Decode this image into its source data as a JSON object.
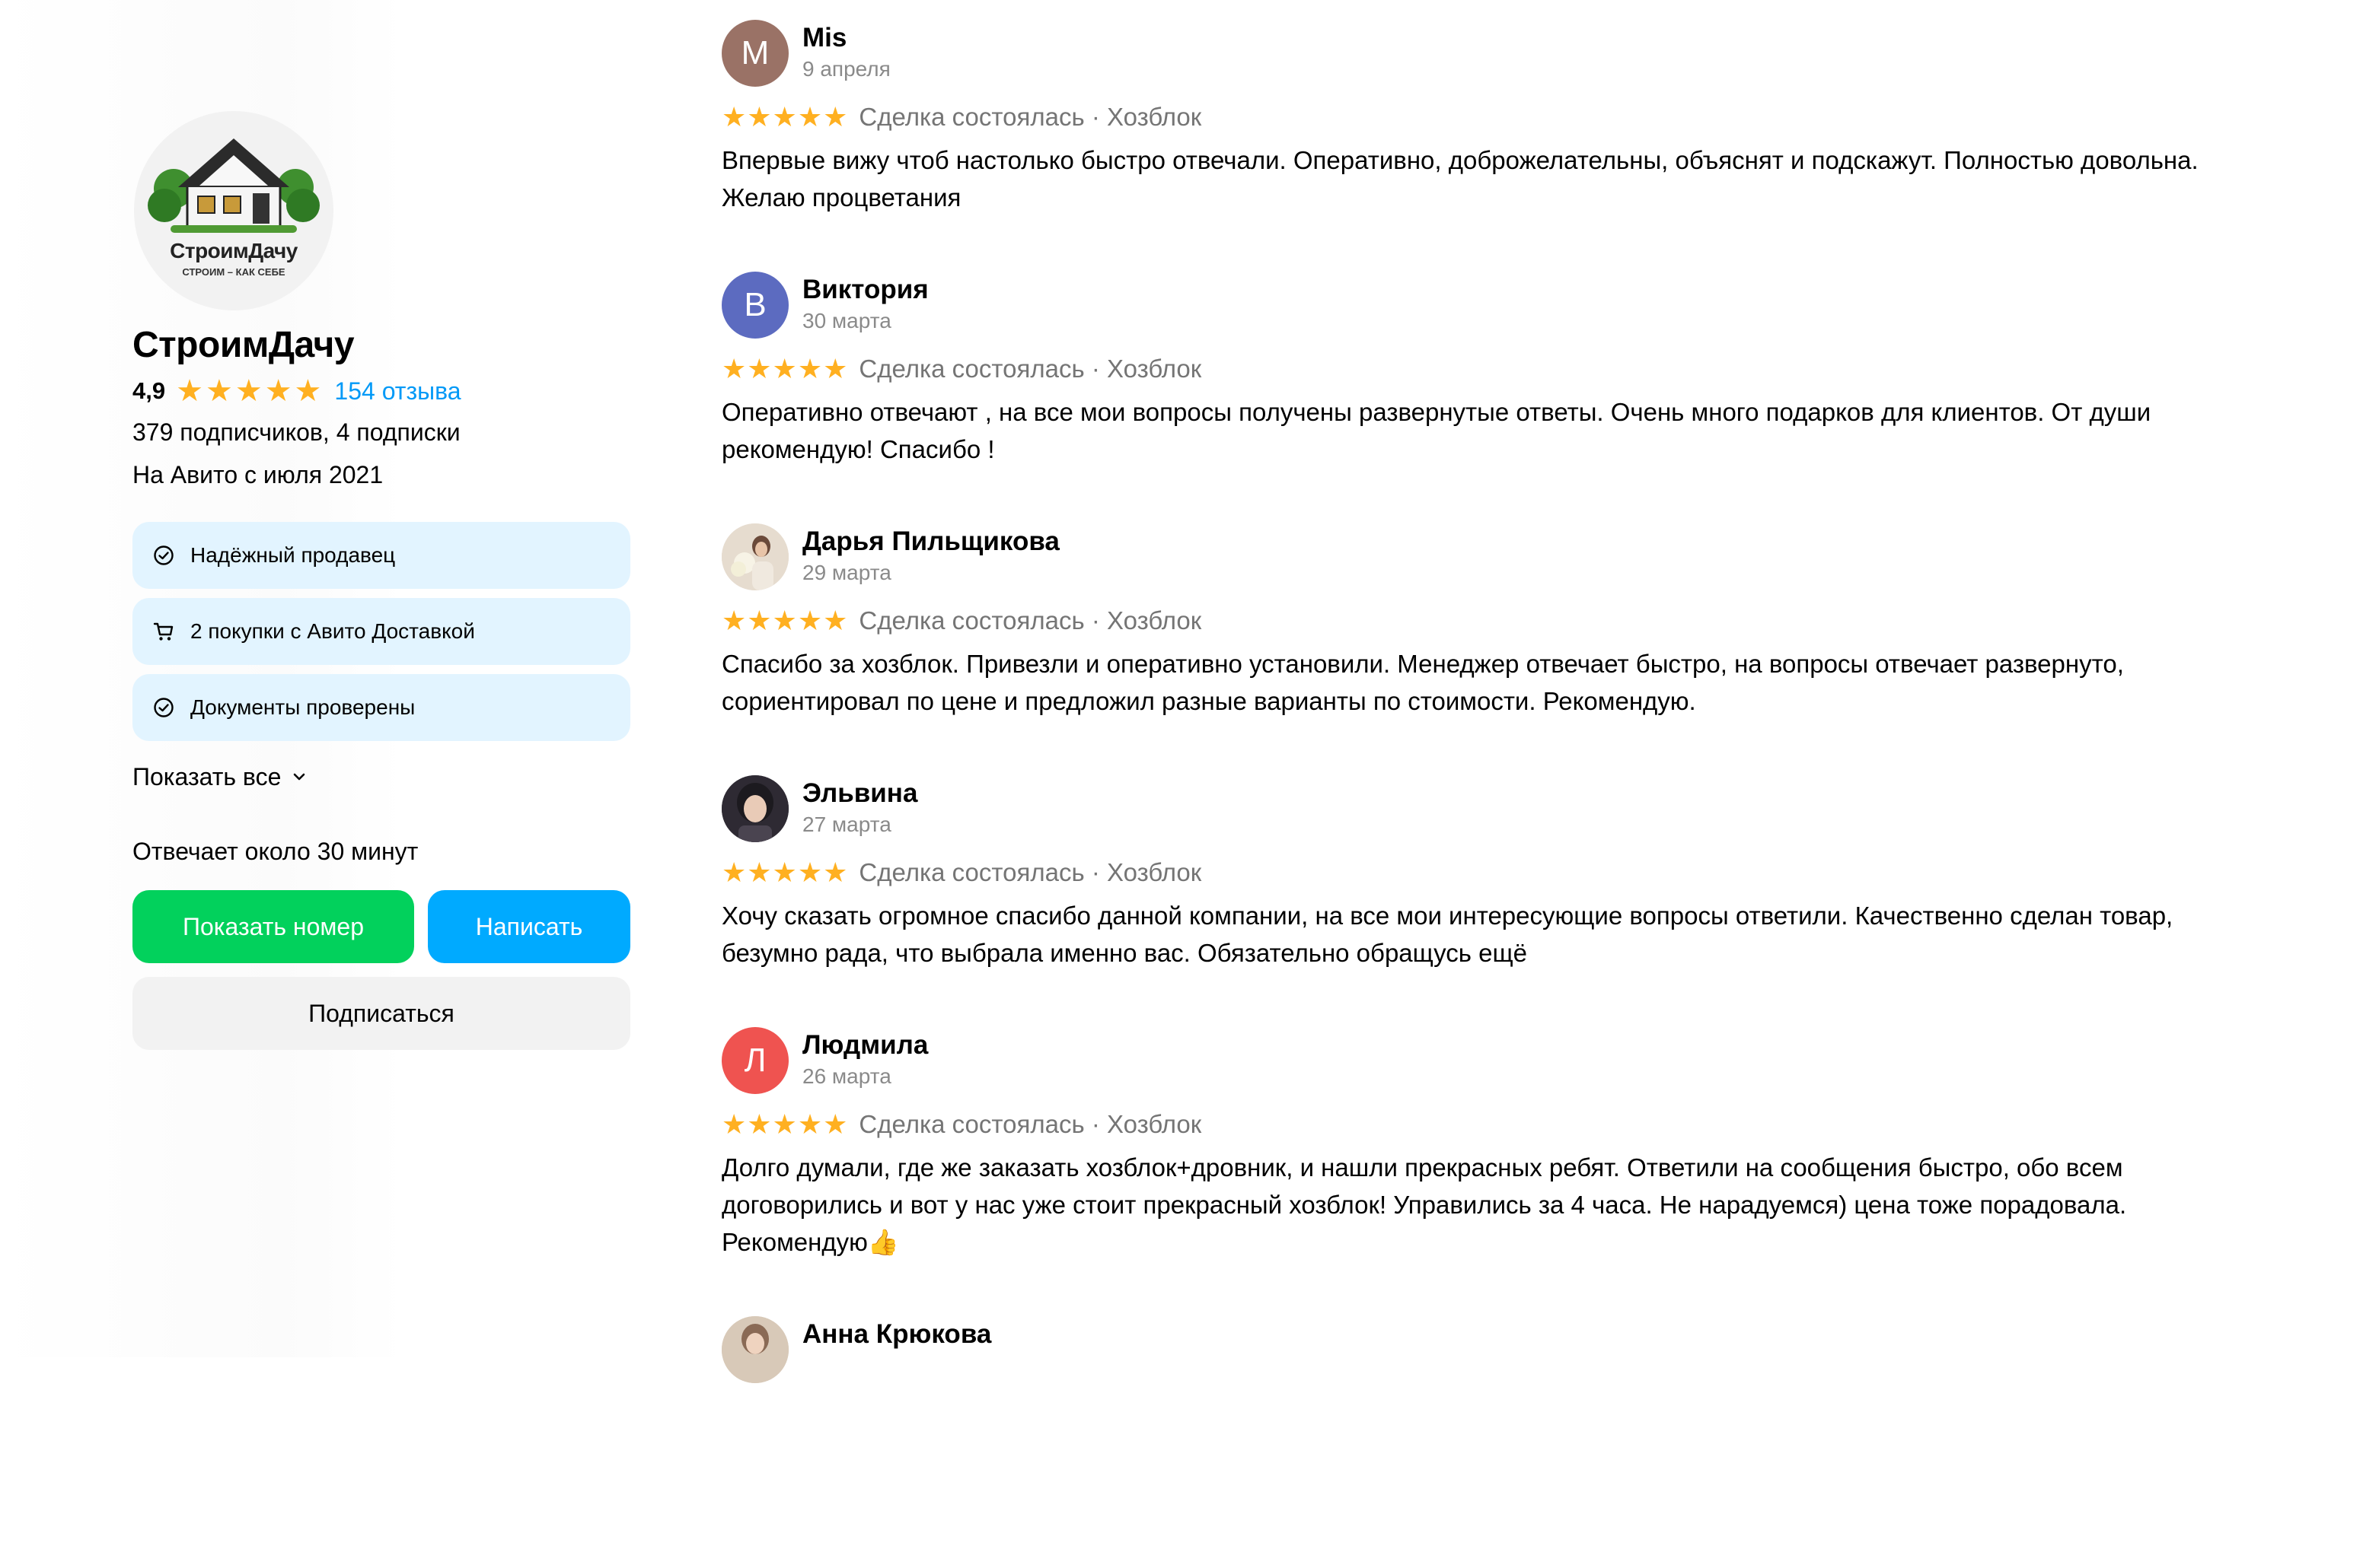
{
  "seller": {
    "logo_title": "СтроимДачу",
    "logo_subtitle": "СТРОИМ – КАК СЕБЕ",
    "name": "СтроимДачу",
    "rating": "4,9",
    "stars": "★★★★★",
    "reviews_link": "154 отзыва",
    "followers": "379 подписчиков, 4 подписки",
    "since": "На Авито с июля 2021",
    "badges": [
      {
        "icon": "check-circle-icon",
        "label": "Надёжный продавец"
      },
      {
        "icon": "cart-icon",
        "label": "2 покупки с Авито Доставкой"
      },
      {
        "icon": "check-circle-icon",
        "label": "Документы проверены"
      }
    ],
    "show_all": "Показать все",
    "response_time": "Отвечает около 30 минут",
    "show_phone_label": "Показать номер",
    "write_label": "Написать",
    "subscribe_label": "Подписаться"
  },
  "colors": {
    "green_button": "#02d15c",
    "blue_button": "#00aaff",
    "badge_bg": "#e2f4ff",
    "star": "#ffb021",
    "link": "#0099f7"
  },
  "reviews": [
    {
      "author": "Mis",
      "initial": "М",
      "avatar_color": "#9a7266",
      "avatar_type": "letter",
      "date": "9 апреля",
      "stars": "★★★★★",
      "deal": "Сделка состоялась · Хозблок",
      "text": "Впервые вижу чтоб настолько быстро отвечали. Оперативно, доброжелательны, объяснят и подскажут. Полностью довольна. Желаю процветания"
    },
    {
      "author": "Виктория",
      "initial": "В",
      "avatar_color": "#5c6bc0",
      "avatar_type": "letter",
      "date": "30 марта",
      "stars": "★★★★★",
      "deal": "Сделка состоялась · Хозблок",
      "text": "Оперативно отвечают , на все мои вопросы получены развернутые ответы. Очень много подарков для клиентов. От души рекомендую! Спасибо !"
    },
    {
      "author": "Дарья Пильщикова",
      "initial": "",
      "avatar_color": "#d9c9b5",
      "avatar_type": "photo",
      "date": "29 марта",
      "stars": "★★★★★",
      "deal": "Сделка состоялась · Хозблок",
      "text": "Спасибо за хозблок. Привезли и оперативно установили. Менеджер отвечает быстро, на вопросы отвечает развернуто, сориентировал по цене и предложил разные варианты по стоимости. Рекомендую."
    },
    {
      "author": "Эльвина",
      "initial": "",
      "avatar_color": "#3a3540",
      "avatar_type": "photo",
      "date": "27 марта",
      "stars": "★★★★★",
      "deal": "Сделка состоялась · Хозблок",
      "text": "Хочу сказать огромное спасибо данной компании, на все мои интересующие вопросы ответили. Качественно сделан товар, безумно рада, что выбрала именно вас. Обязательно обращусь ещё"
    },
    {
      "author": "Людмила",
      "initial": "Л",
      "avatar_color": "#ef5350",
      "avatar_type": "letter",
      "date": "26 марта",
      "stars": "★★★★★",
      "deal": "Сделка состоялась · Хозблок",
      "text": "Долго думали, где же заказать хозблок+дровник, и нашли прекрасных ребят. Ответили на сообщения быстро, обо всем договорились и вот у нас уже стоит прекрасный хозблок! Управились за 4 часа. Не нарадуемся) цена тоже порадовала. Рекомендую👍"
    },
    {
      "author": "Анна Крюкова",
      "initial": "",
      "avatar_color": "#c9b8a6",
      "avatar_type": "photo",
      "date": "",
      "stars": "",
      "deal": "",
      "text": ""
    }
  ]
}
